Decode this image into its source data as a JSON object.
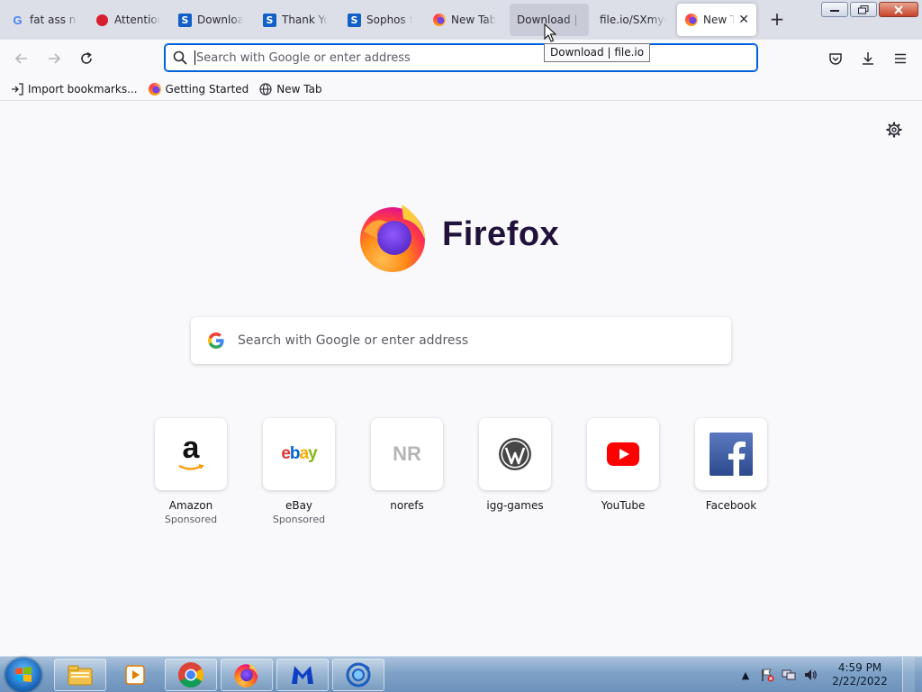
{
  "tabs": [
    {
      "label": "fat ass nig",
      "icon": "google-icon"
    },
    {
      "label": "Attention",
      "icon": "red-dot-icon"
    },
    {
      "label": "Download",
      "icon": "sophos-icon"
    },
    {
      "label": "Thank You",
      "icon": "sophos-icon"
    },
    {
      "label": "Sophos fi",
      "icon": "sophos-icon"
    },
    {
      "label": "New Tab",
      "icon": "firefox-icon"
    },
    {
      "label": "Download | fi",
      "icon": "none",
      "state": "hover"
    },
    {
      "label": "file.io/SXmye",
      "icon": "none",
      "state": "selected"
    },
    {
      "label": "New Tab",
      "icon": "firefox-icon"
    }
  ],
  "tooltip": "Download | file.io",
  "urlbar": {
    "placeholder": "Search with Google or enter address"
  },
  "bookmarks": [
    {
      "label": "Import bookmarks...",
      "icon": "import-icon"
    },
    {
      "label": "Getting Started",
      "icon": "firefox-icon"
    },
    {
      "label": "New Tab",
      "icon": "globe-icon"
    }
  ],
  "newtab": {
    "wordmark": "Firefox",
    "search_placeholder": "Search with Google or enter address",
    "top_sites": [
      {
        "title": "Amazon",
        "sponsor": "Sponsored"
      },
      {
        "title": "eBay",
        "sponsor": "Sponsored"
      },
      {
        "title": "norefs",
        "sponsor": ""
      },
      {
        "title": "igg-games",
        "sponsor": ""
      },
      {
        "title": "YouTube",
        "sponsor": ""
      },
      {
        "title": "Facebook",
        "sponsor": ""
      }
    ],
    "nr_text": "NR"
  },
  "taskbar": {
    "items": [
      "explorer-icon",
      "media-player-icon",
      "chrome-icon",
      "firefox-icon",
      "malwarebytes-icon",
      "sophos-update-icon"
    ]
  },
  "clock": {
    "time": "4:59 PM",
    "date": "2/22/2022"
  },
  "colors": {
    "accent": "#0061e0",
    "tabstrip": "#dcdfe8",
    "page": "#f9f9fb"
  }
}
